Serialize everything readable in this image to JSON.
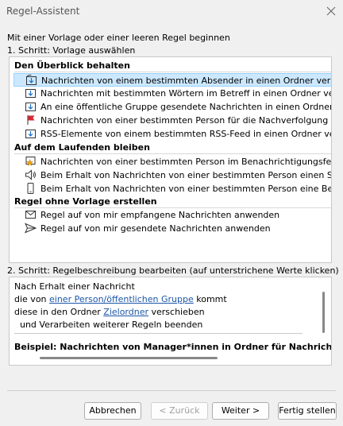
{
  "window": {
    "title": "Regel-Assistent"
  },
  "intro": "Mit einer Vorlage oder einer leeren Regel beginnen",
  "step1": "1. Schritt: Vorlage auswählen",
  "sections": [
    {
      "title": "Den Überblick behalten",
      "items": [
        {
          "label": "Nachrichten von einem bestimmten Absender in einen Ordner verschieben",
          "icon": "folder-arrow-icon",
          "selected": true
        },
        {
          "label": "Nachrichten mit bestimmten Wörtern im Betreff in einen Ordner verschieben",
          "icon": "folder-arrow-icon"
        },
        {
          "label": "An eine öffentliche Gruppe gesendete Nachrichten in einen Ordner verschieben",
          "icon": "folder-arrow-icon"
        },
        {
          "label": "Nachrichten von einer bestimmten Person für die Nachverfolgung kennzeichnen",
          "icon": "red-flag-icon"
        },
        {
          "label": "RSS-Elemente von einem bestimmten RSS-Feed in einen Ordner verschieben",
          "icon": "folder-arrow-icon"
        }
      ]
    },
    {
      "title": "Auf dem Laufenden bleiben",
      "items": [
        {
          "label": "Nachrichten von einer bestimmten Person im Benachrichtigungsfenster für neue Elemente anzeigen",
          "icon": "notification-star-icon"
        },
        {
          "label": "Beim Erhalt von Nachrichten von einer bestimmten Person einen Sound wiedergeben",
          "icon": "speaker-icon"
        },
        {
          "label": "Beim Erhalt von Nachrichten von einer bestimmten Person eine Benachrichtigung senden",
          "icon": "phone-icon"
        }
      ]
    },
    {
      "title": "Regel ohne Vorlage erstellen",
      "items": [
        {
          "label": "Regel auf von mir empfangene Nachrichten anwenden",
          "icon": "envelope-icon"
        },
        {
          "label": "Regel auf von mir gesendete Nachrichten anwenden",
          "icon": "send-icon"
        }
      ]
    }
  ],
  "step2": "2. Schritt: Regelbeschreibung bearbeiten (auf unterstrichene Werte klicken)",
  "description": {
    "line1": "Nach Erhalt einer Nachricht",
    "line2_pre": "die von ",
    "line2_link": "einer Person/öffentlichen Gruppe",
    "line2_post": " kommt",
    "line3_pre": "diese in den Ordner ",
    "line3_link": "Zielordner",
    "line3_post": " verschieben",
    "line4": "  und Verarbeiten weiterer Regeln beenden",
    "example": "Beispiel: Nachrichten von Manager*innen in Ordner für Nachrichten mit hoher Wichtigkeit verschieben"
  },
  "buttons": {
    "cancel": "Abbrechen",
    "back": "< Zurück",
    "next": "Weiter >",
    "finish": "Fertig stellen"
  }
}
